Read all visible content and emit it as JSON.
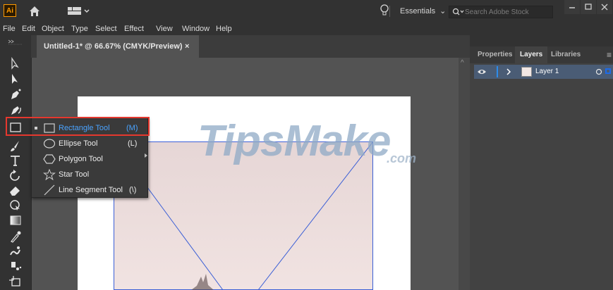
{
  "app": {
    "logo_text": "Ai"
  },
  "header": {
    "workspace": "Essentials",
    "search_placeholder": "Search Adobe Stock"
  },
  "menu": [
    "File",
    "Edit",
    "Object",
    "Type",
    "Select",
    "Effect",
    "View",
    "Window",
    "Help"
  ],
  "document": {
    "tab_title": "Untitled-1* @ 66.67% (CMYK/Preview)",
    "close_glyph": "×"
  },
  "flyout": {
    "items": [
      {
        "label": "Rectangle Tool",
        "shortcut": "(M)",
        "icon": "rectangle-icon",
        "active": true
      },
      {
        "label": "Ellipse Tool",
        "shortcut": "(L)",
        "icon": "ellipse-icon"
      },
      {
        "label": "Polygon Tool",
        "shortcut": "",
        "icon": "polygon-icon"
      },
      {
        "label": "Star Tool",
        "shortcut": "",
        "icon": "star-icon"
      },
      {
        "label": "Line Segment Tool",
        "shortcut": "(\\)",
        "icon": "line-segment-icon"
      }
    ]
  },
  "panel": {
    "tabs": [
      "Properties",
      "Layers",
      "Libraries"
    ],
    "active_tab": "Layers",
    "layers": [
      {
        "name": "Layer 1"
      }
    ]
  },
  "watermark": {
    "brand": "TipsMake",
    "suffix": ".com"
  },
  "colors": {
    "accent_blue": "#2d8ceb",
    "highlight_red": "#e5382e",
    "illustrator_orange": "#ff9a00",
    "active_tool_text": "#4aa3ff"
  }
}
